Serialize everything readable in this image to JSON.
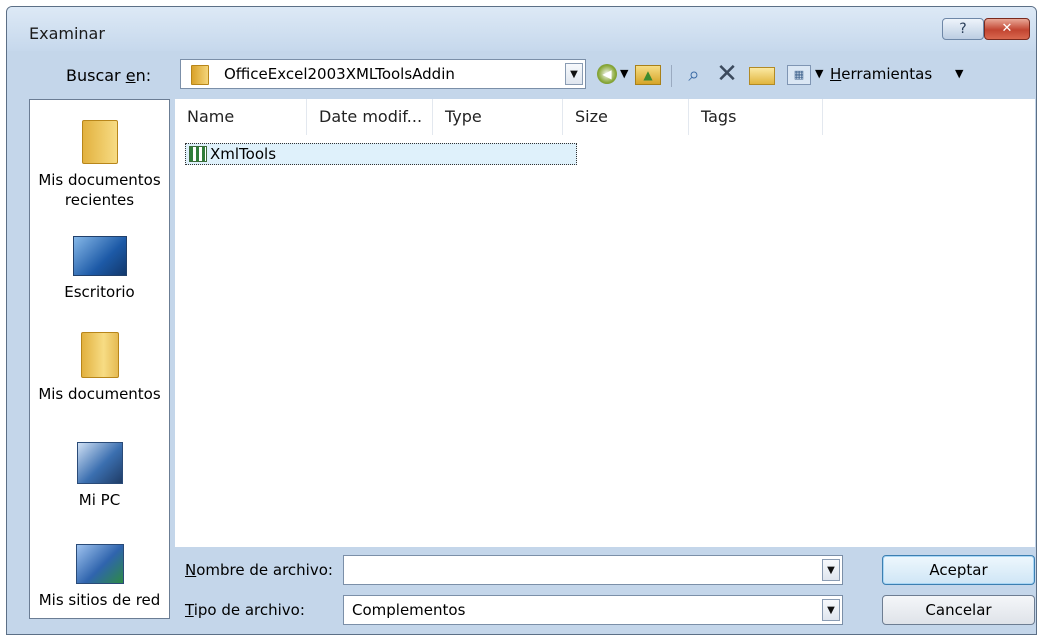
{
  "window": {
    "title": "Examinar",
    "help_glyph": "?",
    "close_glyph": "✕"
  },
  "lookin": {
    "label_prefix": "Buscar ",
    "label_accel": "e",
    "label_suffix": "n:",
    "value": "OfficeExcel2003XMLToolsAddin"
  },
  "toolbar": {
    "tools_accel": "H",
    "tools_rest": "erramientas",
    "back_icon": "back-icon",
    "up_icon": "up-folder-icon",
    "search_icon": "search-icon",
    "delete_icon": "delete-icon",
    "newfolder_icon": "new-folder-icon",
    "views_icon": "views-icon"
  },
  "places": [
    {
      "line1": "Mis documentos",
      "line2": "recientes"
    },
    {
      "line1": "Escritorio",
      "line2": ""
    },
    {
      "line1": "Mis documentos",
      "line2": ""
    },
    {
      "line1": "Mi PC",
      "line2": ""
    },
    {
      "line1": "Mis sitios de red",
      "line2": ""
    }
  ],
  "columns": {
    "name": "Name",
    "date": "Date modif...",
    "type": "Type",
    "size": "Size",
    "tags": "Tags"
  },
  "files": [
    {
      "name": "XmlTools"
    }
  ],
  "filename": {
    "label_accel": "N",
    "label_rest": "ombre de archivo:",
    "value": ""
  },
  "filetype": {
    "label_accel": "T",
    "label_rest": "ipo de archivo:",
    "value": "Complementos"
  },
  "buttons": {
    "ok": "Aceptar",
    "cancel": "Cancelar"
  },
  "colors": {
    "chrome": "#c4d6ea",
    "selection": "#dff1fb",
    "close": "#c24531"
  }
}
